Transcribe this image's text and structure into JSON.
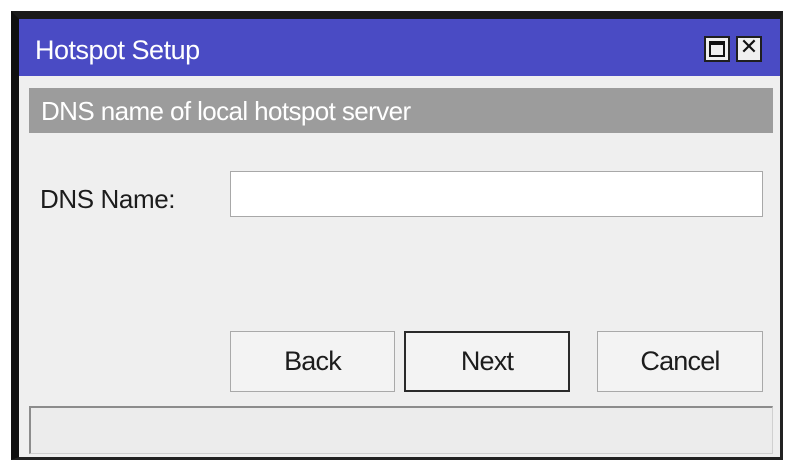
{
  "window": {
    "title": "Hotspot Setup",
    "maximize_icon": "maximize-icon",
    "close_icon": "close-icon",
    "titlebar_color": "#4a4bc4"
  },
  "banner": {
    "text": "DNS name of local hotspot server"
  },
  "form": {
    "dns_label": "DNS Name:",
    "dns_value": ""
  },
  "buttons": {
    "back": "Back",
    "next": "Next",
    "cancel": "Cancel"
  },
  "status": {
    "text": ""
  }
}
